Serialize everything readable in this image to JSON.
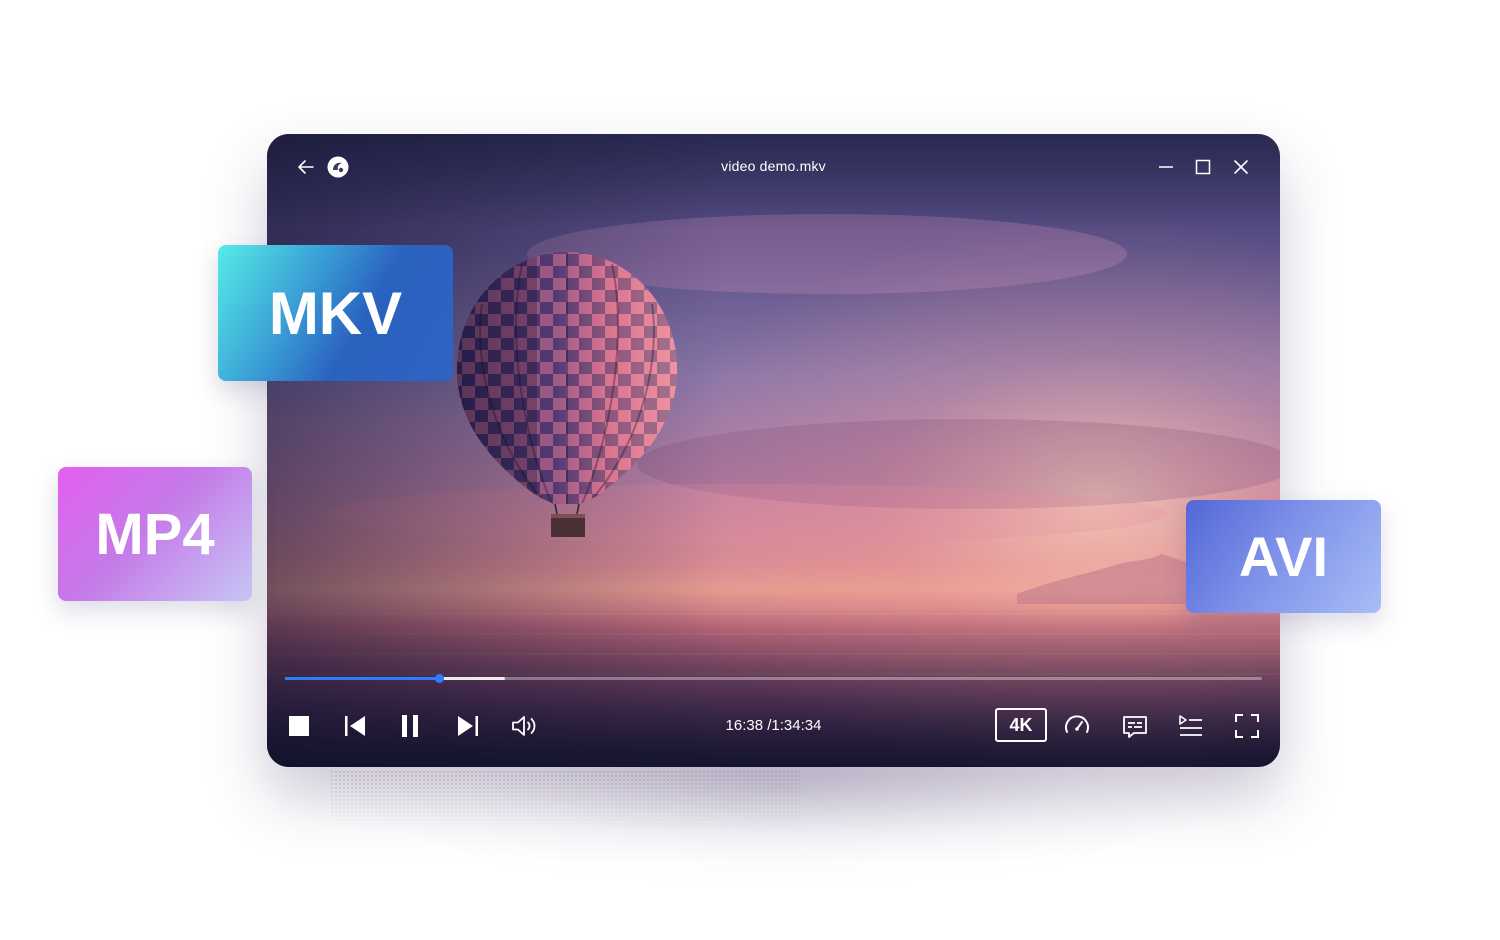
{
  "window": {
    "title": "video demo.mkv"
  },
  "player": {
    "current_time": "16:38",
    "total_time": "/1:34:34",
    "progress": 0.158,
    "buffered": 0.225,
    "quality_label": "4K"
  },
  "format_tags": {
    "mkv": "MKV",
    "mp4": "MP4",
    "avi": "AVI"
  },
  "icons": {
    "back": "arrow-left-icon",
    "logo": "app-logo-icon",
    "minimize": "minimize-icon",
    "maximize": "maximize-icon",
    "close": "close-icon",
    "stop": "stop-icon",
    "previous": "skip-previous-icon",
    "pause": "pause-icon",
    "next": "skip-next-icon",
    "volume": "volume-icon",
    "speed": "speedometer-icon",
    "subtitles": "subtitles-icon",
    "playlist": "playlist-icon",
    "fullscreen": "fullscreen-icon"
  },
  "colors": {
    "accent": "#2f7bff"
  }
}
